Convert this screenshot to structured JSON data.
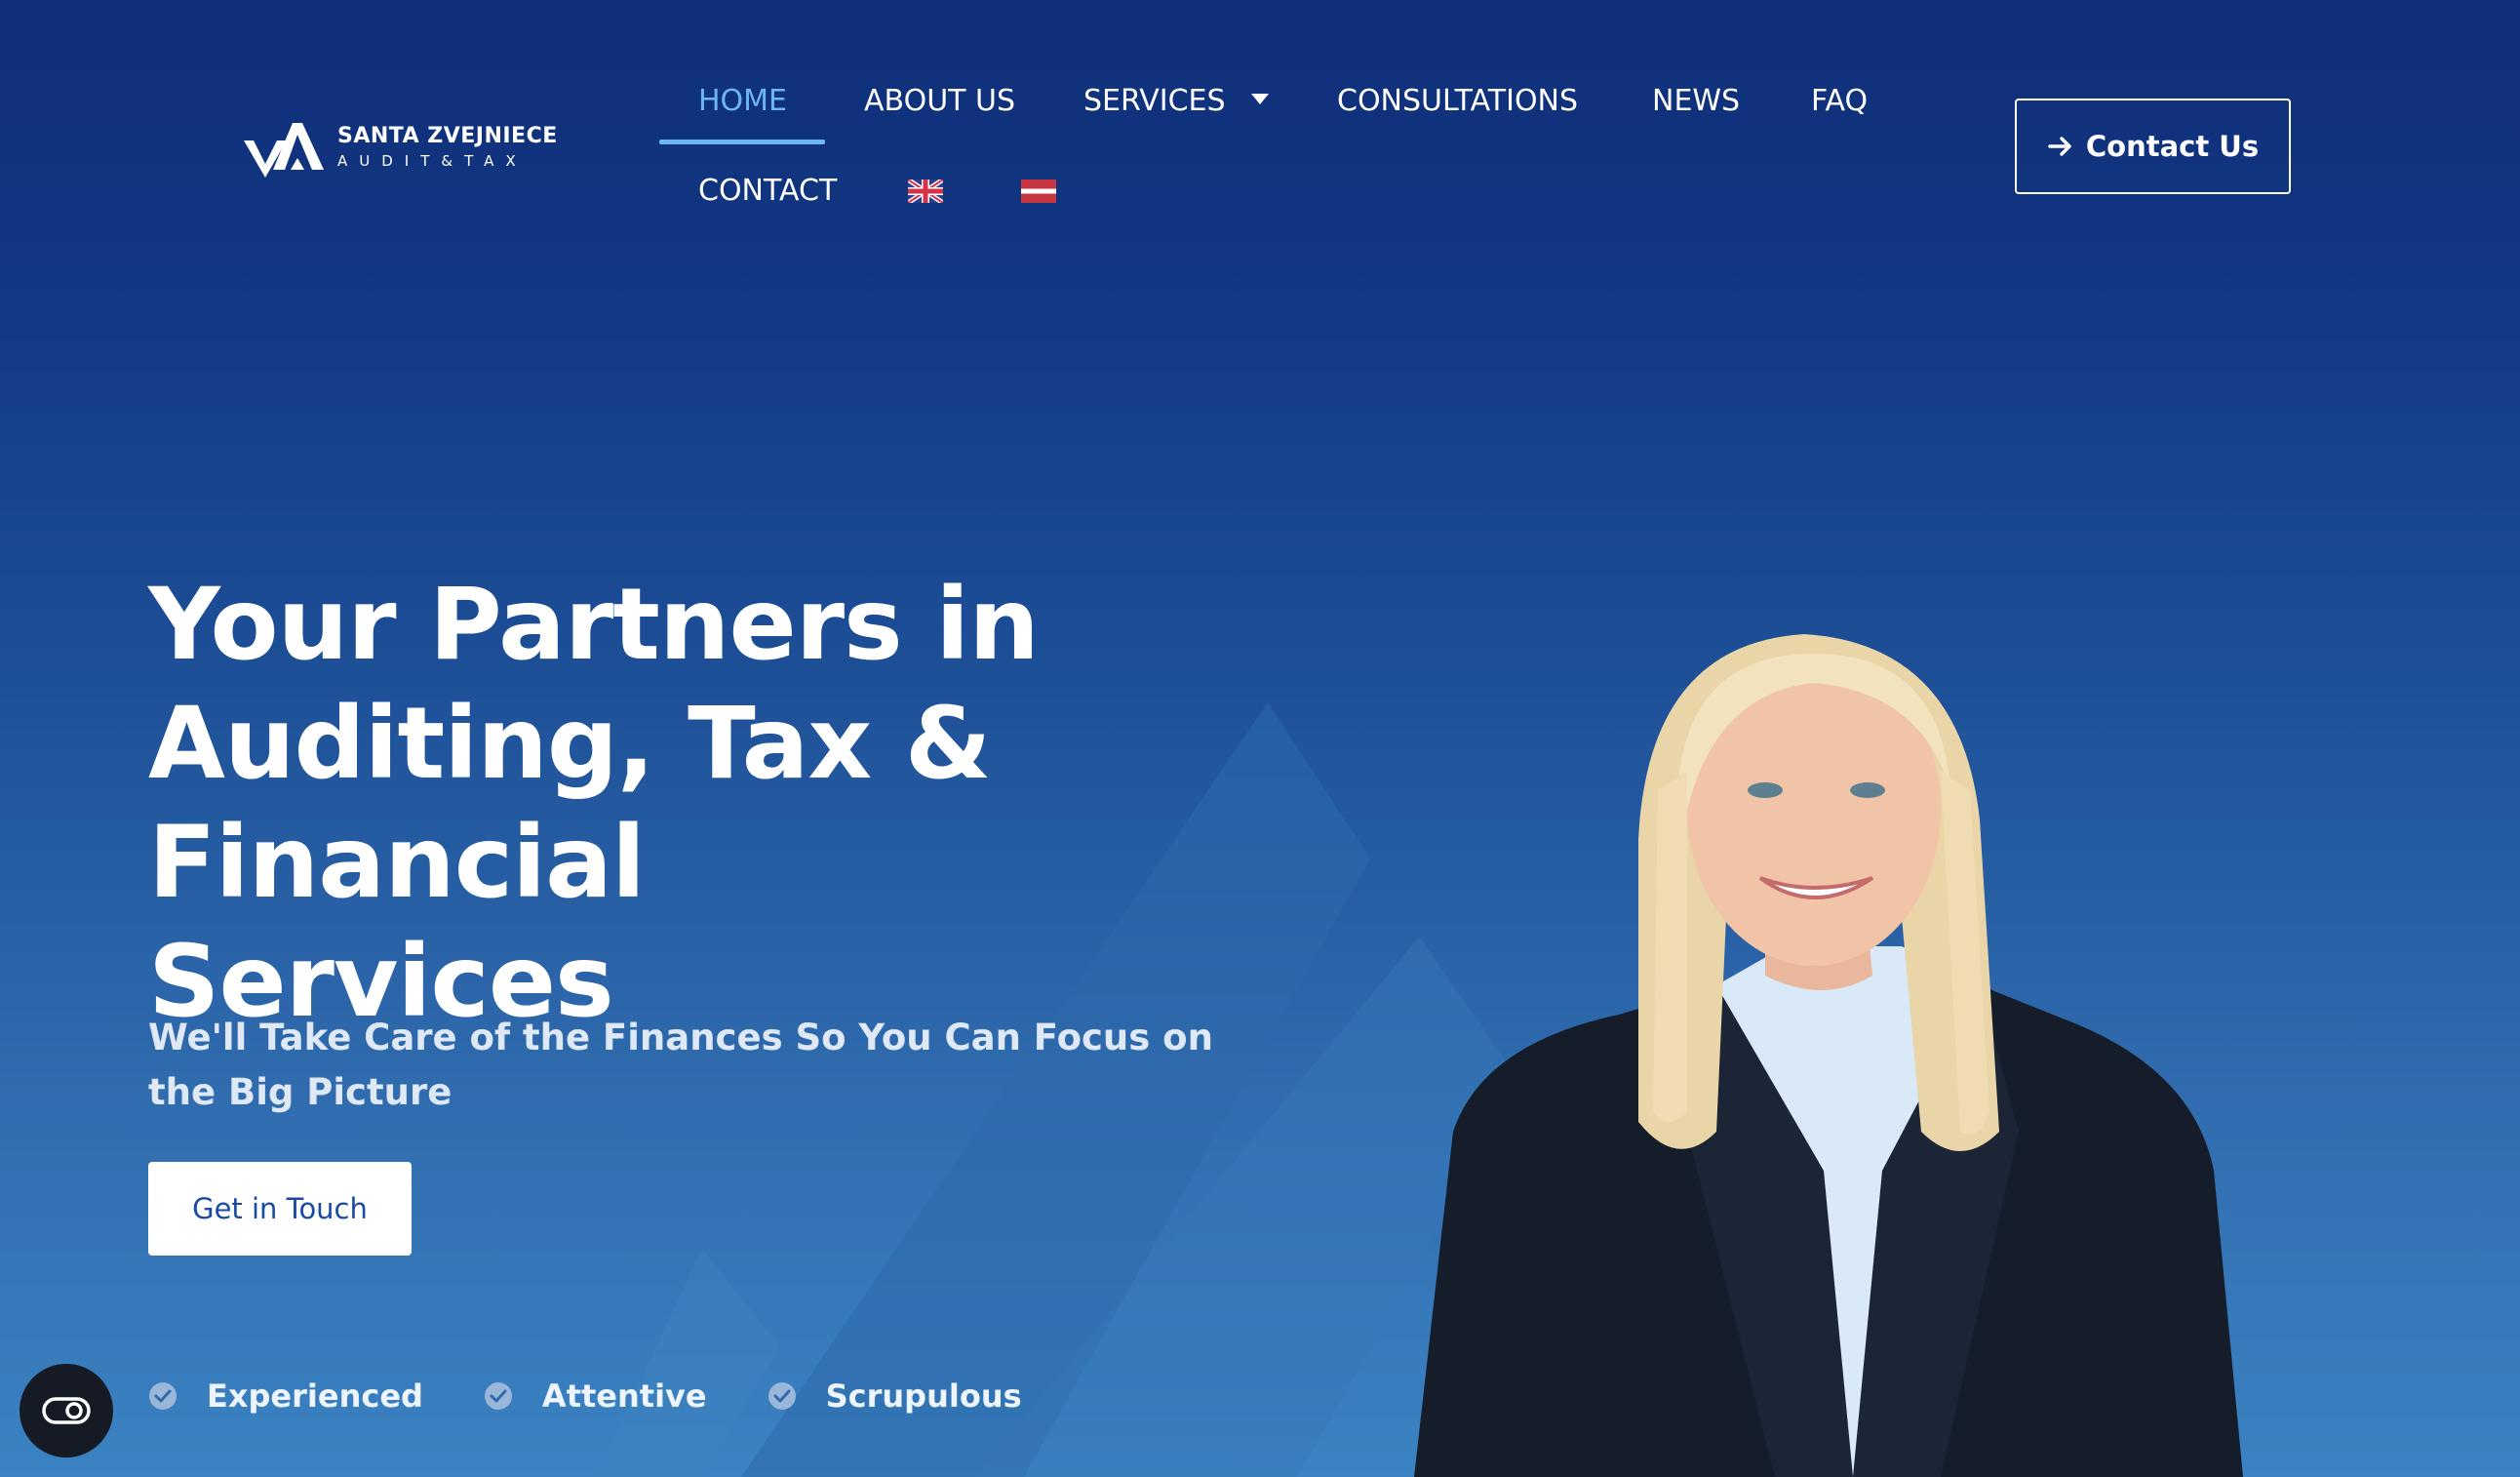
{
  "brand": {
    "name": "SANTA ZVEJNIECE",
    "tagline": "AUDIT&TAX"
  },
  "nav": {
    "items": [
      {
        "label": "HOME",
        "active": true
      },
      {
        "label": "ABOUT US"
      },
      {
        "label": "SERVICES",
        "has_dropdown": true
      },
      {
        "label": "CONSULTATIONS"
      },
      {
        "label": "NEWS"
      },
      {
        "label": "FAQ"
      },
      {
        "label": "CONTACT"
      }
    ],
    "languages": [
      {
        "icon": "uk-flag-icon",
        "code": "en"
      },
      {
        "icon": "latvia-flag-icon",
        "code": "lv"
      }
    ],
    "active_color": "#6cb6f2"
  },
  "header_cta": {
    "label": "Contact Us",
    "icon": "arrow-right-icon"
  },
  "hero": {
    "title_lines": [
      "Your Partners in",
      "Auditing, Tax & Financial",
      "Services"
    ],
    "subtitle": "We'll Take Care of the Finances So You Can Focus on the Big Picture",
    "cta_label": "Get in Touch",
    "features": [
      {
        "label": "Experienced",
        "icon": "check-circle-icon"
      },
      {
        "label": "Attentive",
        "icon": "check-circle-icon"
      },
      {
        "label": "Scrupulous",
        "icon": "check-circle-icon"
      }
    ]
  },
  "accessibility": {
    "icon": "accessibility-toggle-icon"
  },
  "colors": {
    "background_top": "#0f2f78",
    "background_bottom": "#3b83c2",
    "cta_text": "#1a4aa3",
    "white": "#ffffff"
  }
}
